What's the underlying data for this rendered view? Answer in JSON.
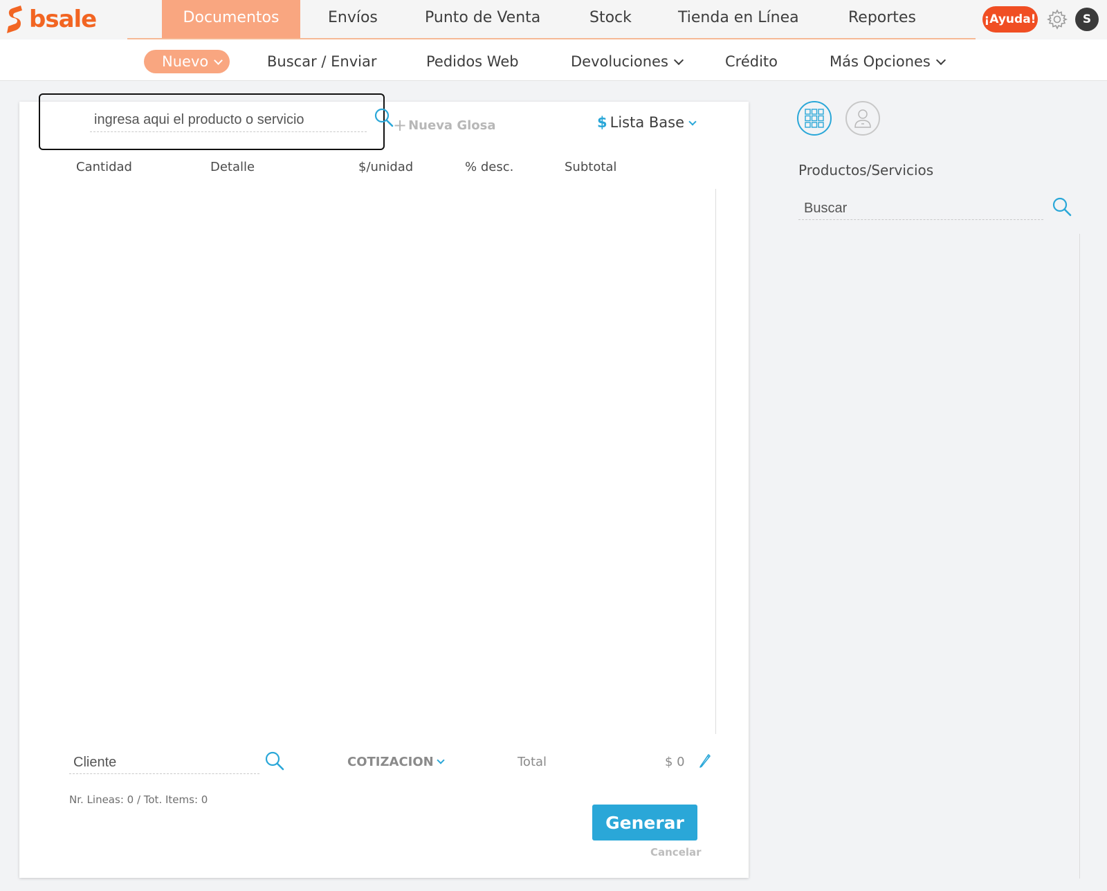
{
  "app": {
    "logo_text": "bsale",
    "brand_color": "#f26522",
    "accent_color": "#2aa7d8"
  },
  "main_nav": [
    {
      "label": "Documentos",
      "active": true
    },
    {
      "label": "Envíos"
    },
    {
      "label": "Punto de Venta"
    },
    {
      "label": "Stock"
    },
    {
      "label": "Tienda en Línea"
    },
    {
      "label": "Reportes"
    }
  ],
  "header": {
    "help_label": "¡Ayuda!",
    "avatar_initial": "S",
    "settings_icon": "gear-icon"
  },
  "sub_nav": [
    {
      "label": "Nuevo",
      "active": true,
      "dropdown": true
    },
    {
      "label": "Buscar / Enviar"
    },
    {
      "label": "Pedidos Web"
    },
    {
      "label": "Devoluciones",
      "dropdown": true
    },
    {
      "label": "Crédito"
    },
    {
      "label": "Más Opciones",
      "dropdown": true
    }
  ],
  "document": {
    "product_placeholder": "ingresa aqui el producto o servicio",
    "nueva_glosa": "Nueva Glosa",
    "price_list_symbol": "$",
    "price_list": "Lista Base",
    "columns": [
      "Cantidad",
      "Detalle",
      "$/unidad",
      "% desc.",
      "Subtotal"
    ],
    "client_placeholder": "Cliente",
    "doc_type": "COTIZACION",
    "total_label": "Total",
    "total_value": "$ 0",
    "lines_info": "Nr. Lineas: 0 / Tot. Items: 0",
    "generate_label": "Generar",
    "cancel_label": "Cancelar"
  },
  "side_panel": {
    "title": "Productos/Servicios",
    "search_placeholder": "Buscar"
  }
}
